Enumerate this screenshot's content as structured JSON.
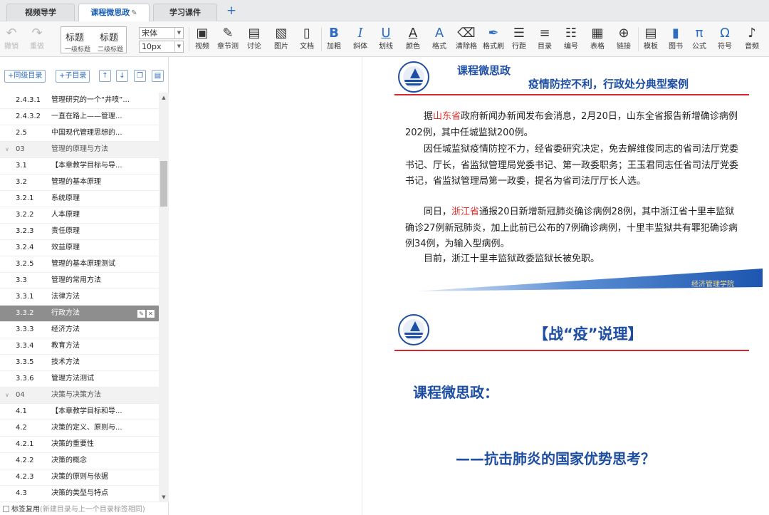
{
  "tabs": [
    {
      "label": "视频导学",
      "active": false
    },
    {
      "label": "课程微思政",
      "active": true
    },
    {
      "label": "学习课件",
      "active": false
    }
  ],
  "add_tab": "+",
  "toolbar": {
    "undo": "撤销",
    "redo": "重做",
    "style_h1": "标题",
    "style_h2": "标题",
    "style_h1_sub": "一级标题",
    "style_h2_sub": "二级标题",
    "font_family": "宋体",
    "font_size": "10px",
    "video": "视频",
    "chapter_test": "章节测",
    "discuss": "讨论",
    "image": "图片",
    "document": "文档",
    "bold_icon": "B",
    "bold": "加粗",
    "italic_icon": "I",
    "italic": "斜体",
    "underline_icon": "U",
    "underline": "划线",
    "color_icon": "A",
    "color": "颜色",
    "format_icon": "A",
    "format": "格式",
    "clear_format": "清除格",
    "format_brush": "格式刷",
    "line_spacing": "行距",
    "toc": "目录",
    "numbering": "编号",
    "table": "表格",
    "link": "链接",
    "template": "模板",
    "book": "图书",
    "formula_icon": "π",
    "formula": "公式",
    "symbol_icon": "Ω",
    "symbol": "符号",
    "audio": "音频"
  },
  "outline_buttons": {
    "add_sibling": "+同级目录",
    "add_child": "+子目录"
  },
  "outline": [
    {
      "num": "2.4.3.1",
      "title": "管理研究的一个“井喷”...",
      "type": "item"
    },
    {
      "num": "2.4.3.2",
      "title": "一直在路上——管理...",
      "type": "item"
    },
    {
      "num": "2.5",
      "title": "中国现代管理思想的...",
      "type": "item"
    },
    {
      "num": "03",
      "title": "管理的原理与方法",
      "type": "chapter"
    },
    {
      "num": "3.1",
      "title": "【本章教学目标与导...",
      "type": "item"
    },
    {
      "num": "3.2",
      "title": "管理的基本原理",
      "type": "item"
    },
    {
      "num": "3.2.1",
      "title": "系统原理",
      "type": "item"
    },
    {
      "num": "3.2.2",
      "title": "人本原理",
      "type": "item"
    },
    {
      "num": "3.2.3",
      "title": "责任原理",
      "type": "item"
    },
    {
      "num": "3.2.4",
      "title": "效益原理",
      "type": "item"
    },
    {
      "num": "3.2.5",
      "title": "管理的基本原理测试",
      "type": "item"
    },
    {
      "num": "3.3",
      "title": "管理的常用方法",
      "type": "item"
    },
    {
      "num": "3.3.1",
      "title": "法律方法",
      "type": "item"
    },
    {
      "num": "3.3.2",
      "title": "行政方法",
      "type": "selected"
    },
    {
      "num": "3.3.3",
      "title": "经济方法",
      "type": "item"
    },
    {
      "num": "3.3.4",
      "title": "教育方法",
      "type": "item"
    },
    {
      "num": "3.3.5",
      "title": "技术方法",
      "type": "item"
    },
    {
      "num": "3.3.6",
      "title": "管理方法测试",
      "type": "item"
    },
    {
      "num": "04",
      "title": "决策与决策方法",
      "type": "chapter"
    },
    {
      "num": "4.1",
      "title": "【本章教学目标和导...",
      "type": "item"
    },
    {
      "num": "4.2",
      "title": "决策的定义、原则与...",
      "type": "item"
    },
    {
      "num": "4.2.1",
      "title": "决策的重要性",
      "type": "item"
    },
    {
      "num": "4.2.2",
      "title": "决策的概念",
      "type": "item"
    },
    {
      "num": "4.2.3",
      "title": "决策的原则与依据",
      "type": "item"
    },
    {
      "num": "4.3",
      "title": "决策的类型与特点",
      "type": "item"
    }
  ],
  "footer": {
    "label": "标签复用",
    "hint": "(新建目录与上一个目录标签相同)"
  },
  "slide1": {
    "title": "课程微思政",
    "headline": "疫情防控不利，行政处分典型案例",
    "p1_prefix": "据",
    "p1_hl": "山东省",
    "p1_rest": "政府新闻办新闻发布会消息，2月20日，山东全省报告新增确诊病例202例，其中任城监狱200例。",
    "p2": "因任城监狱疫情防控不力，经省委研究决定，免去解维俊同志的省司法厅党委书记、厅长，省监狱管理局党委书记、第一政委职务；王玉君同志任省司法厅党委书记，省监狱管理局第一政委，提名为省司法厅厅长人选。",
    "p3_prefix": "同日，",
    "p3_hl": "浙江省",
    "p3_rest": "通报20日新增新冠肺炎确诊病例28例，其中浙江省十里丰监狱确诊27例新冠肺炎，加上此前已公布的7例确诊病例，十里丰监狱共有罪犯确诊病例34例，为输入型病例。",
    "p4": "目前，浙江十里丰监狱政委监狱长被免职。",
    "band_label": "经济管理学院"
  },
  "slide2": {
    "title": "【战“疫”说理】",
    "subtitle": "课程微思政：",
    "question": "——抗击肺炎的国家优势思考？"
  },
  "colors": {
    "brand_blue": "#1d4ea3",
    "accent_red": "#d7262d",
    "highlight_red": "#e0302c"
  }
}
